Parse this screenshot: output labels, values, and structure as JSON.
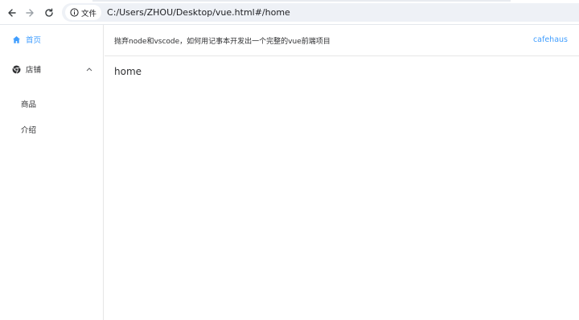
{
  "browser": {
    "address_chip_label": "文件",
    "url": "C:/Users/ZHOU/Desktop/vue.html#/home",
    "icons": [
      "back-arrow-icon",
      "forward-arrow-icon",
      "reload-icon",
      "info-icon"
    ]
  },
  "sidebar": {
    "accent_color": "#409eff",
    "items": [
      {
        "label": "首页",
        "icon": "home-icon",
        "active": true
      },
      {
        "label": "店铺",
        "icon": "chrome-icon",
        "expanded": true
      },
      {
        "label": "商品"
      },
      {
        "label": "介绍"
      }
    ]
  },
  "header": {
    "title": "抛弃node和vscode，如何用记事本开发出一个完整的vue前端项目",
    "link": "cafehaus"
  },
  "main": {
    "content": "home"
  }
}
